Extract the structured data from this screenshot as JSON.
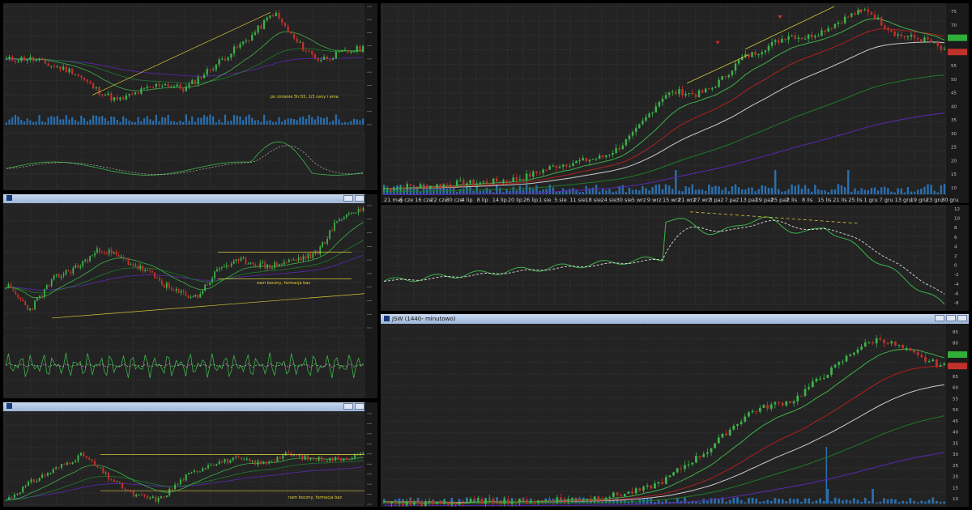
{
  "colors": {
    "background": "#232323",
    "up": "#3cb34a",
    "down": "#c0312b",
    "ma_fast": "#3fb04a",
    "ma_slow": "#1e7a2a",
    "ma_red": "#b02020",
    "ma_white": "#cccccc",
    "ma_purple": "#5a28b4",
    "trend": "#d8c83a",
    "volume": "#2a6fae",
    "axis_label_green": "#2fae3a"
  },
  "panels": {
    "daily_main": {
      "x_labels": [
        "21 maj",
        "6 cze",
        "16 cze",
        "22 cze",
        "30 cze",
        "4 lip",
        "8 lip",
        "14 lip",
        "20 lip",
        "26 lip",
        "1 sie",
        "5 sie",
        "11 sie",
        "18 sie",
        "24 sie",
        "30 sie",
        "5 wrz",
        "9 wrz",
        "15 wrz",
        "21 wrz",
        "27 wrz",
        "3 paź",
        "7 paź",
        "13 paź",
        "19 paź",
        "25 paź",
        "2 lis",
        "8 lis",
        "15 lis",
        "21 lis",
        "25 lis",
        "1 gru",
        "7 gru",
        "13 gru",
        "19 gru",
        "23 gru",
        "30 gru"
      ],
      "y_labels": [
        "75",
        "70",
        "65",
        "60",
        "55",
        "50",
        "45",
        "40",
        "35",
        "30",
        "25",
        "20",
        "15",
        "10"
      ],
      "osc_y_labels": [
        "12",
        "10",
        "8",
        "6",
        "4",
        "2",
        "0",
        "-2",
        "-4",
        "-6",
        "-8"
      ]
    },
    "minute_1440": {
      "title": "JSW (1440- minutowo)",
      "y_labels": [
        "85",
        "80",
        "75",
        "70",
        "65",
        "60",
        "55",
        "50",
        "45",
        "40",
        "35",
        "30",
        "25",
        "20",
        "15",
        "10"
      ]
    },
    "top_left": {
      "annotation": "po zmianie 5h:55, 2/3 ceny i ema"
    },
    "mid_left": {
      "annotation": "nam boczny, formacja baz"
    },
    "bottom_left": {
      "annotation": "nam boczny, formacja baz"
    }
  },
  "chart_data": [
    {
      "type": "line",
      "title": "JSW",
      "xlabel": "",
      "ylabel": "",
      "x": [
        "21 maj",
        "6 cze",
        "16 cze",
        "22 cze",
        "30 cze",
        "4 lip",
        "8 lip",
        "14 lip",
        "20 lip",
        "26 lip",
        "1 sie",
        "5 sie",
        "11 sie",
        "18 sie",
        "24 sie",
        "30 sie",
        "5 wrz",
        "9 wrz",
        "15 wrz",
        "21 wrz",
        "27 wrz",
        "3 paź",
        "7 paź",
        "13 paź",
        "19 paź",
        "25 paź",
        "2 lis",
        "8 lis",
        "15 lis",
        "21 lis",
        "25 lis",
        "1 gru",
        "7 gru",
        "13 gru",
        "19 gru",
        "23 gru",
        "30 gru"
      ],
      "series": [
        {
          "values": [
            12,
            12.5,
            13,
            13,
            13.5,
            14,
            14,
            14.5,
            15,
            16,
            18,
            20,
            21,
            22,
            23,
            26,
            31,
            38,
            45,
            46,
            45,
            47,
            52,
            58,
            60,
            63,
            66,
            65,
            67,
            70,
            73,
            75,
            70,
            66,
            65,
            64,
            60
          ]
        }
      ],
      "ylim": [
        10,
        76
      ],
      "grid": true
    },
    {
      "type": "line",
      "title": "JSW (1440- minutowo)",
      "series": [
        {
          "values": [
            10,
            10,
            10,
            10,
            11,
            11,
            11,
            11,
            12,
            12,
            13,
            14,
            16,
            20,
            27,
            33,
            42,
            50,
            53,
            55,
            63,
            70,
            78,
            82,
            78,
            73,
            70
          ]
        }
      ],
      "ylim": [
        10,
        87
      ],
      "grid": true
    }
  ]
}
